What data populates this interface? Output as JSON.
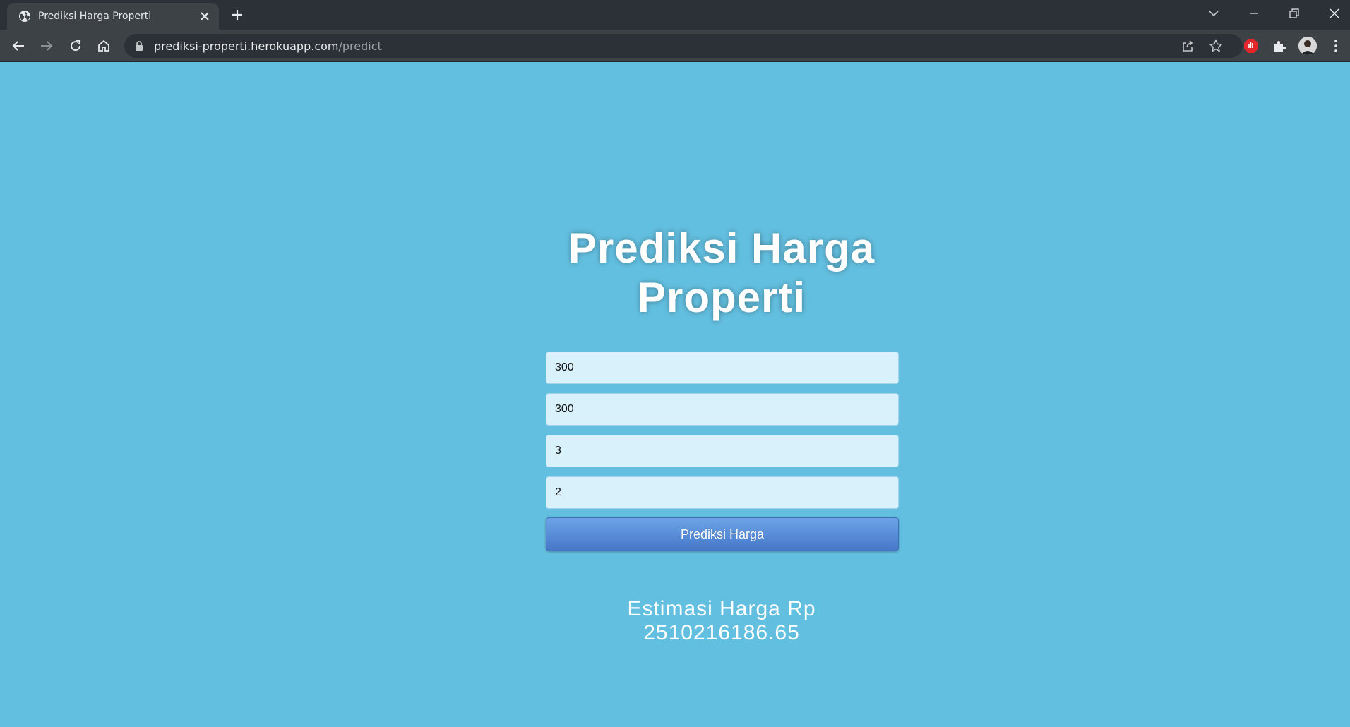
{
  "browser": {
    "tab_title": "Prediksi Harga Properti",
    "url_host": "prediksi-properti.herokuapp.com",
    "url_path": "/predict"
  },
  "page": {
    "heading": "Prediksi Harga Properti",
    "fields": [
      {
        "value": "300"
      },
      {
        "value": "300"
      },
      {
        "value": "3"
      },
      {
        "value": "2"
      }
    ],
    "button_label": "Prediksi Harga",
    "result_label": "Estimasi Harga Rp",
    "result_value": "2510216186.65"
  },
  "colors": {
    "background": "#63bfe0",
    "button": "#5a8ed8",
    "field": "#d9f1fb"
  }
}
